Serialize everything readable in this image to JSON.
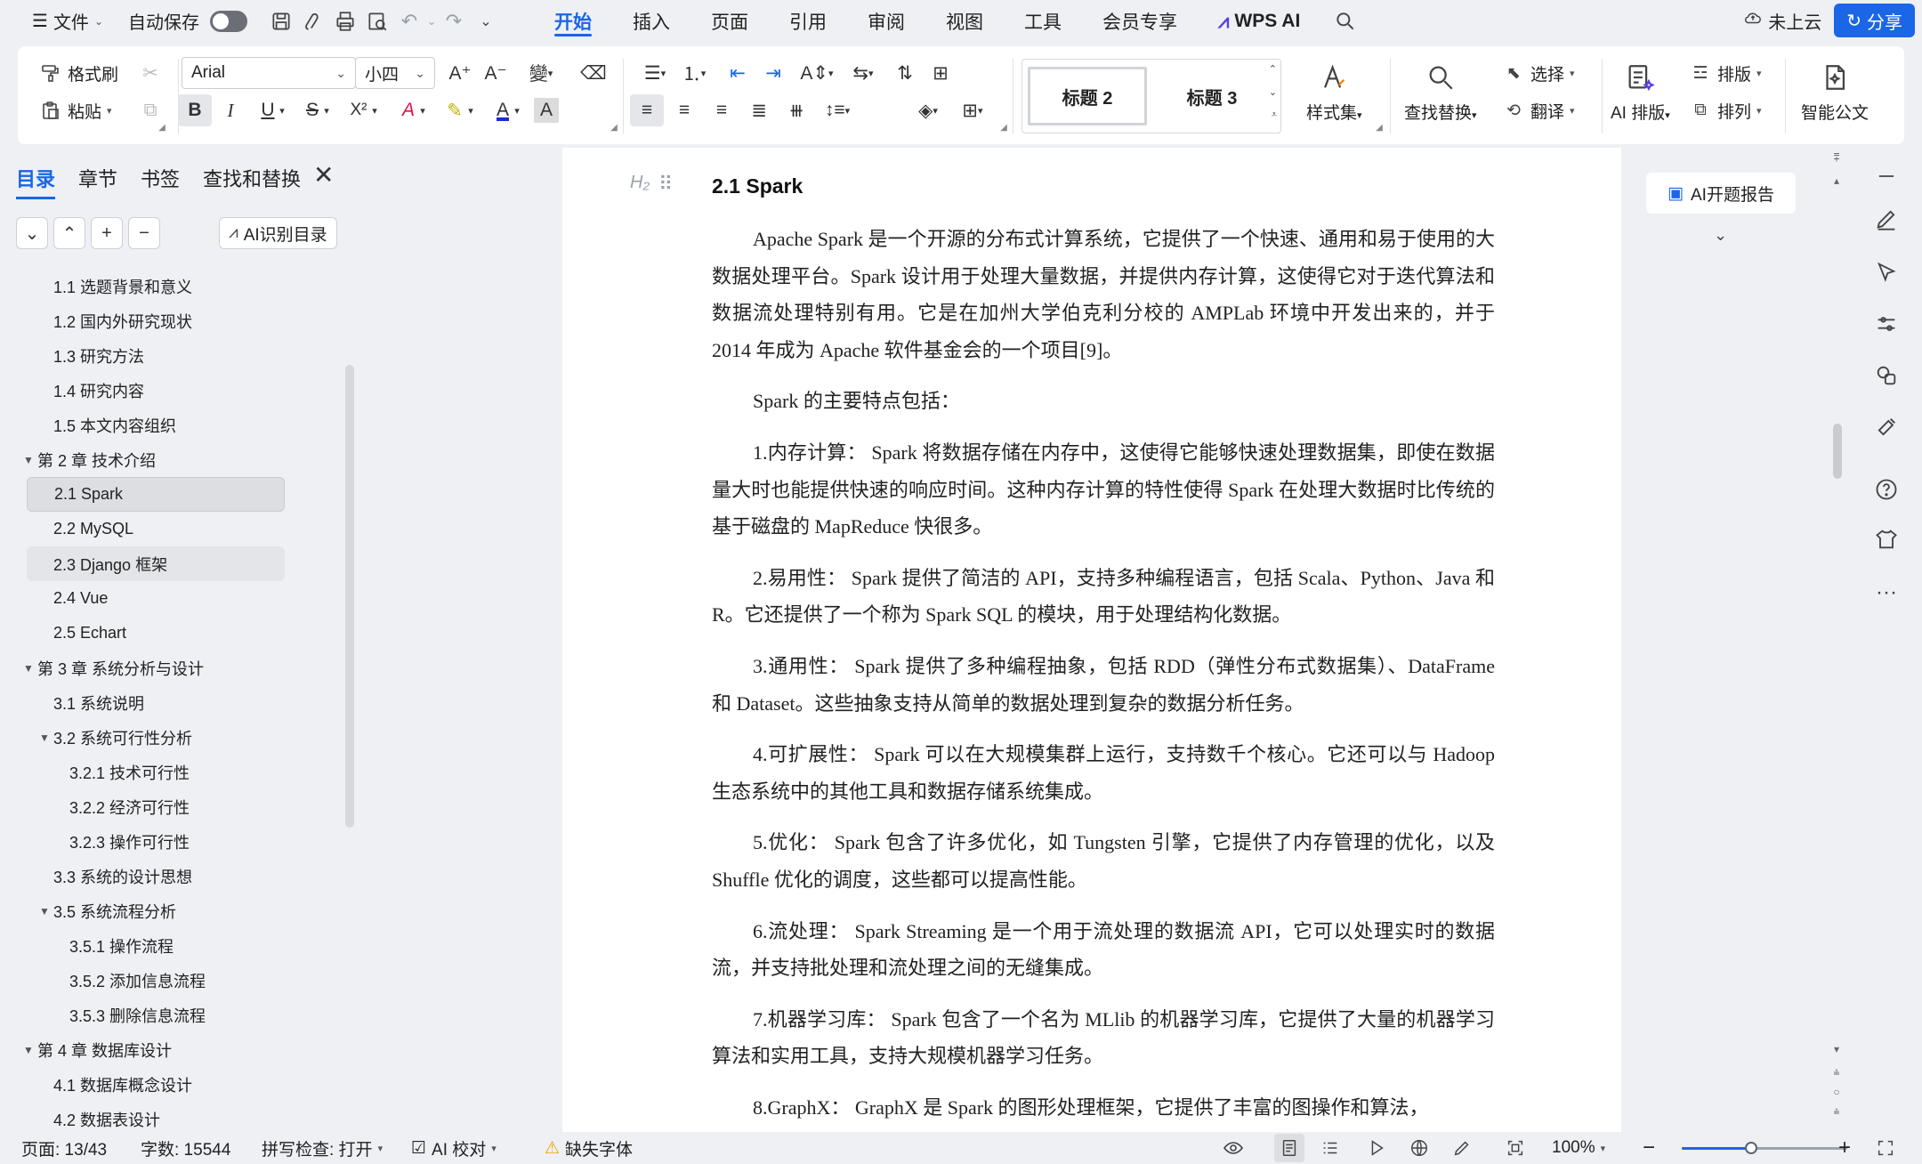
{
  "menubar": {
    "file_label": "文件",
    "autosave_label": "自动保存",
    "tabs": [
      "开始",
      "插入",
      "页面",
      "引用",
      "审阅",
      "视图",
      "工具",
      "会员专享"
    ],
    "wps_ai_label": "WPS AI",
    "cloud_label": "未上云",
    "share_label": "分享"
  },
  "ribbon": {
    "format_painter": "格式刷",
    "paste": "粘贴",
    "font_name": "Arial",
    "font_size": "小四",
    "style_h2": "标题 2",
    "style_h3": "标题 3",
    "styles_label": "样式集",
    "find_replace": "查找替换",
    "select_label": "选择",
    "translate_label": "翻译",
    "ai_layout": "AI 排版",
    "layout_label": "排版",
    "arrange_label": "排列",
    "smart_doc": "智能公文",
    "icons": {
      "bold": "B",
      "italic": "I",
      "underline": "U",
      "strike": "S",
      "superscript": "X²",
      "font_color_letter": "A"
    }
  },
  "navpanel": {
    "tabs": [
      "目录",
      "章节",
      "书签",
      "查找和替换"
    ],
    "ai_toc_label": "AI识别目录",
    "toc": [
      {
        "label": "1.1 选题背景和意义",
        "level": 2
      },
      {
        "label": "1.2 国内外研究现状",
        "level": 2
      },
      {
        "label": "1.3 研究方法",
        "level": 2
      },
      {
        "label": "1.4 研究内容",
        "level": 2
      },
      {
        "label": "1.5 本文内容组织",
        "level": 2
      },
      {
        "label": "第 2 章 技术介绍",
        "level": 1,
        "expanded": true
      },
      {
        "label": "2.1 Spark",
        "level": 2,
        "selected": true
      },
      {
        "label": "2.2 MySQL",
        "level": 2
      },
      {
        "label": "2.3 Django 框架",
        "level": 2,
        "hover": true
      },
      {
        "label": "2.4 Vue",
        "level": 2
      },
      {
        "label": "2.5 Echart",
        "level": 2
      },
      {
        "label": "第 3 章 系统分析与设计",
        "level": 1,
        "expanded": true
      },
      {
        "label": "3.1 系统说明",
        "level": 2
      },
      {
        "label": "3.2 系统可行性分析",
        "level": 2,
        "expanded": true
      },
      {
        "label": "3.2.1 技术可行性",
        "level": 3
      },
      {
        "label": "3.2.2 经济可行性",
        "level": 3
      },
      {
        "label": "3.2.3 操作可行性",
        "level": 3
      },
      {
        "label": "3.3 系统的设计思想",
        "level": 2
      },
      {
        "label": "3.5 系统流程分析",
        "level": 2,
        "expanded": true
      },
      {
        "label": "3.5.1 操作流程",
        "level": 3
      },
      {
        "label": "3.5.2 添加信息流程",
        "level": 3
      },
      {
        "label": "3.5.3 删除信息流程",
        "level": 3
      },
      {
        "label": "第 4 章 数据库设计",
        "level": 1,
        "expanded": true
      },
      {
        "label": "4.1 数据库概念设计",
        "level": 2
      },
      {
        "label": "4.2 数据表设计",
        "level": 2
      }
    ]
  },
  "document": {
    "heading_tag": "H₂",
    "heading": "2.1 Spark",
    "paragraphs": [
      "Apache Spark 是一个开源的分布式计算系统，它提供了一个快速、通用和易于使用的大数据处理平台。Spark 设计用于处理大量数据，并提供内存计算，这使得它对于迭代算法和数据流处理特别有用。它是在加州大学伯克利分校的 AMPLab 环境中开发出来的，并于 2014 年成为 Apache 软件基金会的一个项目[9]。",
      "Spark 的主要特点包括：",
      "1.内存计算： Spark 将数据存储在内存中，这使得它能够快速处理数据集，即使在数据量大时也能提供快速的响应时间。这种内存计算的特性使得 Spark 在处理大数据时比传统的基于磁盘的 MapReduce 快很多。",
      "2.易用性： Spark 提供了简洁的 API，支持多种编程语言，包括 Scala、Python、Java 和 R。它还提供了一个称为 Spark SQL 的模块，用于处理结构化数据。",
      "3.通用性： Spark 提供了多种编程抽象，包括 RDD（弹性分布式数据集）、DataFrame 和 Dataset。这些抽象支持从简单的数据处理到复杂的数据分析任务。",
      "4.可扩展性： Spark 可以在大规模集群上运行，支持数千个核心。它还可以与 Hadoop 生态系统中的其他工具和数据存储系统集成。",
      "5.优化： Spark 包含了许多优化，如 Tungsten 引擎，它提供了内存管理的优化，以及 Shuffle 优化的调度，这些都可以提高性能。",
      "6.流处理： Spark Streaming 是一个用于流处理的数据流 API，它可以处理实时的数据流，并支持批处理和流处理之间的无缝集成。",
      "7.机器学习库： Spark 包含了一个名为 MLlib 的机器学习库，它提供了大量的机器学习算法和实用工具，支持大规模机器学习任务。",
      "8.GraphX： GraphX 是 Spark 的图形处理框架，它提供了丰富的图操作和算法，"
    ]
  },
  "ai_card": {
    "label": "AI开题报告"
  },
  "status": {
    "page": "页面: 13/43",
    "words": "字数: 15544",
    "spellcheck": "拼写检查: 打开",
    "ai_proof": "AI 校对",
    "missing_font": "缺失字体",
    "zoom": "100%",
    "zoom_level": 0.42
  },
  "colors": {
    "accent": "#1a66e6",
    "warning": "#f0a000"
  }
}
